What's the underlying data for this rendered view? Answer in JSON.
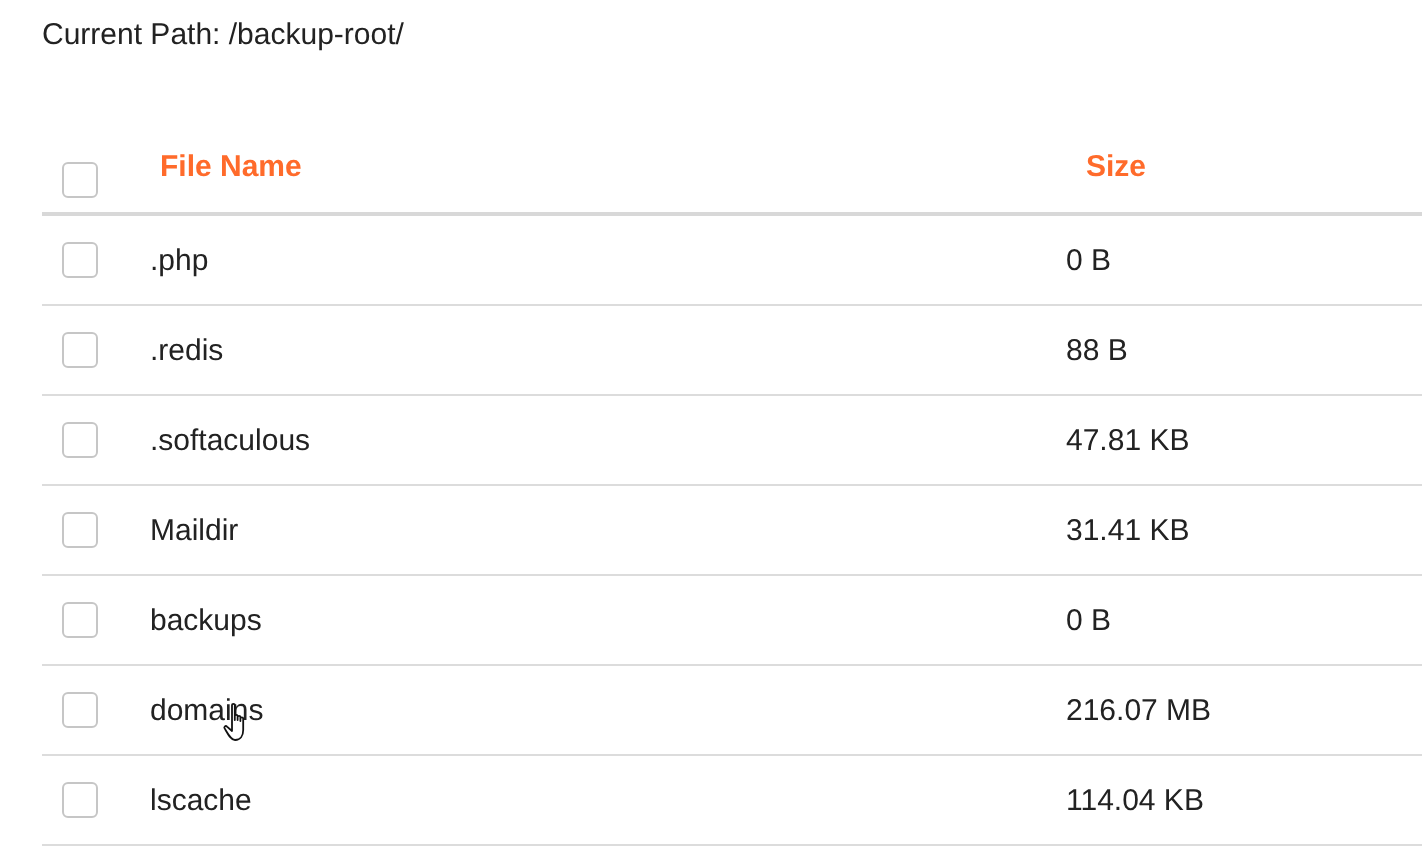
{
  "current_path": {
    "label": "Current Path:",
    "value": "/backup-root/"
  },
  "table": {
    "select_all": {
      "checked": false
    },
    "columns": [
      "File Name",
      "Size"
    ],
    "rows": [
      {
        "name": ".php",
        "size": "0 B",
        "checked": false
      },
      {
        "name": ".redis",
        "size": "88 B",
        "checked": false
      },
      {
        "name": ".softaculous",
        "size": "47.81 KB",
        "checked": false
      },
      {
        "name": "Maildir",
        "size": "31.41 KB",
        "checked": false
      },
      {
        "name": "backups",
        "size": "0 B",
        "checked": false
      },
      {
        "name": "domains",
        "size": "216.07 MB",
        "checked": false,
        "hovered": true
      },
      {
        "name": "lscache",
        "size": "114.04 KB",
        "checked": false
      }
    ]
  }
}
